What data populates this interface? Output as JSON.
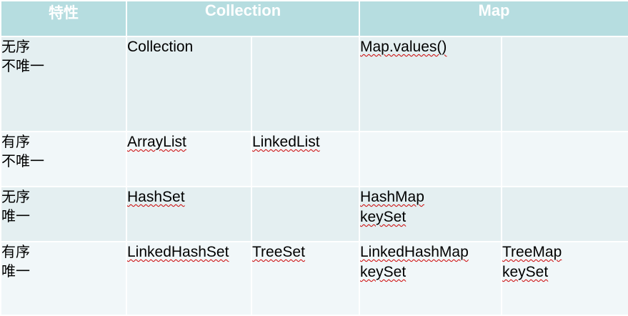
{
  "header": {
    "feature": "特性",
    "collection": "Collection",
    "map": "Map"
  },
  "rows": [
    {
      "feature_line1": "无序",
      "feature_line2": "不唯一",
      "col_a": "Collection",
      "col_b": "",
      "map_a_line1": "Map.values()",
      "map_a_line2": "",
      "map_b_line1": "",
      "map_b_line2": ""
    },
    {
      "feature_line1": "有序",
      "feature_line2": "不唯一",
      "col_a": "ArrayList",
      "col_b": "LinkedList",
      "map_a_line1": "",
      "map_a_line2": "",
      "map_b_line1": "",
      "map_b_line2": ""
    },
    {
      "feature_line1": "无序",
      "feature_line2": "唯一",
      "col_a": "HashSet",
      "col_b": "",
      "map_a_line1": "HashMap",
      "map_a_line2": "keySet",
      "map_b_line1": "",
      "map_b_line2": ""
    },
    {
      "feature_line1": "有序",
      "feature_line2": "唯一",
      "col_a": "LinkedHashSet",
      "col_b": "TreeSet",
      "map_a_line1": "LinkedHashMap",
      "map_a_line2": "keySet",
      "map_b_line1": "TreeMap",
      "map_b_line2": "keySet"
    }
  ]
}
